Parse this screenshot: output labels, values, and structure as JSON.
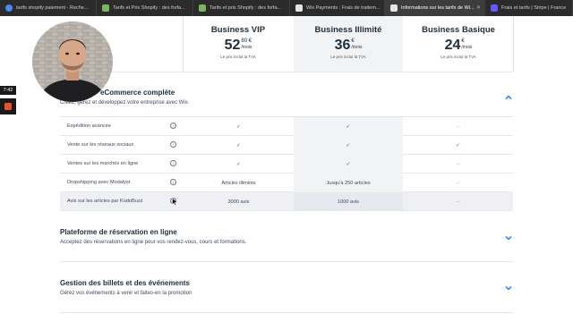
{
  "browser": {
    "tabs": [
      {
        "title": "tarifs shopify paiement - Reche...",
        "color": "#4a8af4",
        "active": false
      },
      {
        "title": "Tarifs et Prix Shopify : des forfa...",
        "color": "#7ab55c",
        "active": false
      },
      {
        "title": "Tarifs et prix Shopify : des forfa...",
        "color": "#7ab55c",
        "active": false
      },
      {
        "title": "Wix Payments : Frais de traitem...",
        "color": "#e5e5e5",
        "active": false
      },
      {
        "title": "Informations sur les tarifs de Wi...",
        "color": "#e5e5e5",
        "active": true
      },
      {
        "title": "Frais et tarifs | Stripe | France",
        "color": "#635bff",
        "active": false
      }
    ]
  },
  "plans": [
    {
      "name": "Business VIP",
      "price_int": "52",
      "price_cents": "80 €",
      "per": "/mois",
      "tva": "Le prix inclut la TVA"
    },
    {
      "name": "Business Illimité",
      "price_int": "36",
      "price_cents": "€",
      "per": "/mois",
      "tva": "Le prix inclut la TVA"
    },
    {
      "name": "Business Basique",
      "price_int": "24",
      "price_cents": "€",
      "per": "/mois",
      "tva": "Le prix inclut la TVA"
    }
  ],
  "ecommerce": {
    "title": "eCommerce complète",
    "subtitle": "Créez, gérez et développez votre entreprise avec Wix.",
    "info_glyph": "i",
    "check_glyph": "✓",
    "dash_glyph": "–",
    "rows": [
      {
        "label": "Expédition avancée",
        "vip": "check",
        "illimite": "check",
        "basique": "dash"
      },
      {
        "label": "Vente sur les réseaux sociaux",
        "vip": "check",
        "illimite": "check",
        "basique": "check"
      },
      {
        "label": "Ventes sur les marchés en ligne",
        "vip": "check",
        "illimite": "check",
        "basique": "dash"
      },
      {
        "label": "Dropshipping avec Modalyst",
        "vip": "Articles illimités",
        "illimite": "Jusqu'à 250 articles",
        "basique": "dash"
      },
      {
        "label": "Avis sur les articles par KudoBuzz",
        "vip": "3000 avis",
        "illimite": "1000 avis",
        "basique": "dash"
      }
    ]
  },
  "reservations": {
    "title": "Plateforme de réservation en ligne",
    "subtitle": "Acceptez des réservations en ligne pour vos rendez-vous, cours et formations."
  },
  "events": {
    "title": "Gestion des billets et des événements",
    "subtitle": "Gérez vos événements à venir et faites-en la promotion"
  },
  "recorder": {
    "timer": "7:42"
  },
  "colors": {
    "accent": "#116dff",
    "shade": "#f2f3f5",
    "stop": "#e8502c"
  },
  "icons": {
    "section_toggle": "chevron-icon",
    "tooltip": "info-icon",
    "webcam": "presenter-webcam"
  }
}
